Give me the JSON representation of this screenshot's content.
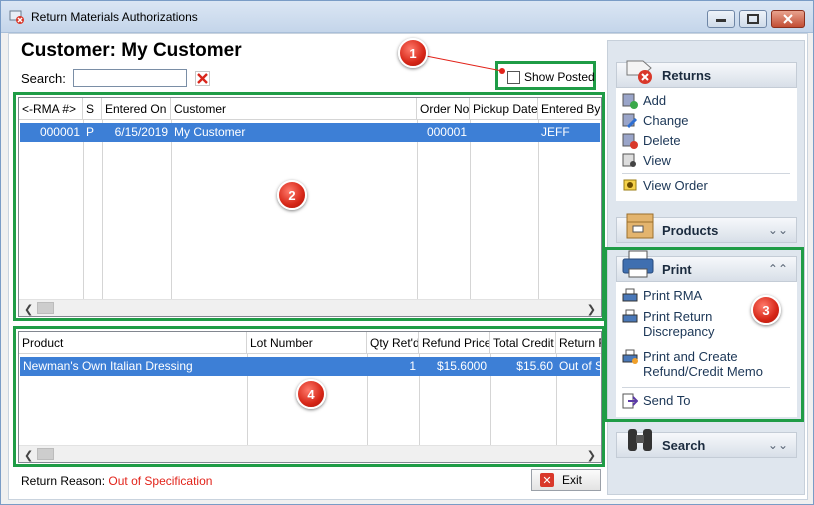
{
  "window": {
    "title": "Return Materials Authorizations"
  },
  "header": {
    "customer_title": "Customer: My Customer",
    "search_label": "Search:",
    "search_value": "",
    "show_posted_label": "Show Posted",
    "show_posted_checked": false
  },
  "markers": [
    "1",
    "2",
    "3",
    "4"
  ],
  "rma_table": {
    "columns": [
      "<-RMA #>",
      "S",
      "Entered On",
      "Customer",
      "Order No.",
      "Pickup Date",
      "Entered By"
    ],
    "rows": [
      {
        "rma": "000001",
        "status": "P",
        "entered_on": "6/15/2019",
        "customer": "My Customer",
        "order_no": "000001",
        "pickup_date": "",
        "entered_by": "JEFF"
      }
    ]
  },
  "lines_table": {
    "columns": [
      "Product",
      "Lot Number",
      "Qty Ret'd",
      "Refund Price",
      "Total Credit",
      "Return R"
    ],
    "rows": [
      {
        "product": "Newman's Own Italian Dressing",
        "lot": "",
        "qty": "1",
        "refund_price": "$15.6000",
        "total_credit": "$15.60",
        "reason": "Out of Sp"
      }
    ]
  },
  "footer": {
    "reason_label": "Return Reason:",
    "reason_value": "Out of Specification",
    "exit_label": "Exit"
  },
  "sidebar": {
    "returns": {
      "title": "Returns",
      "items": [
        "Add",
        "Change",
        "Delete",
        "View",
        "View Order"
      ]
    },
    "products": {
      "title": "Products"
    },
    "print": {
      "title": "Print",
      "items": [
        "Print RMA",
        "Print Return Discrepancy",
        "Print and Create Refund/Credit Memo",
        "Send To"
      ]
    },
    "search": {
      "title": "Search"
    }
  },
  "colors": {
    "highlight": "#1f9c46",
    "selection": "#3d7fd6",
    "marker": "#d62617",
    "reason": "#e2231a"
  }
}
